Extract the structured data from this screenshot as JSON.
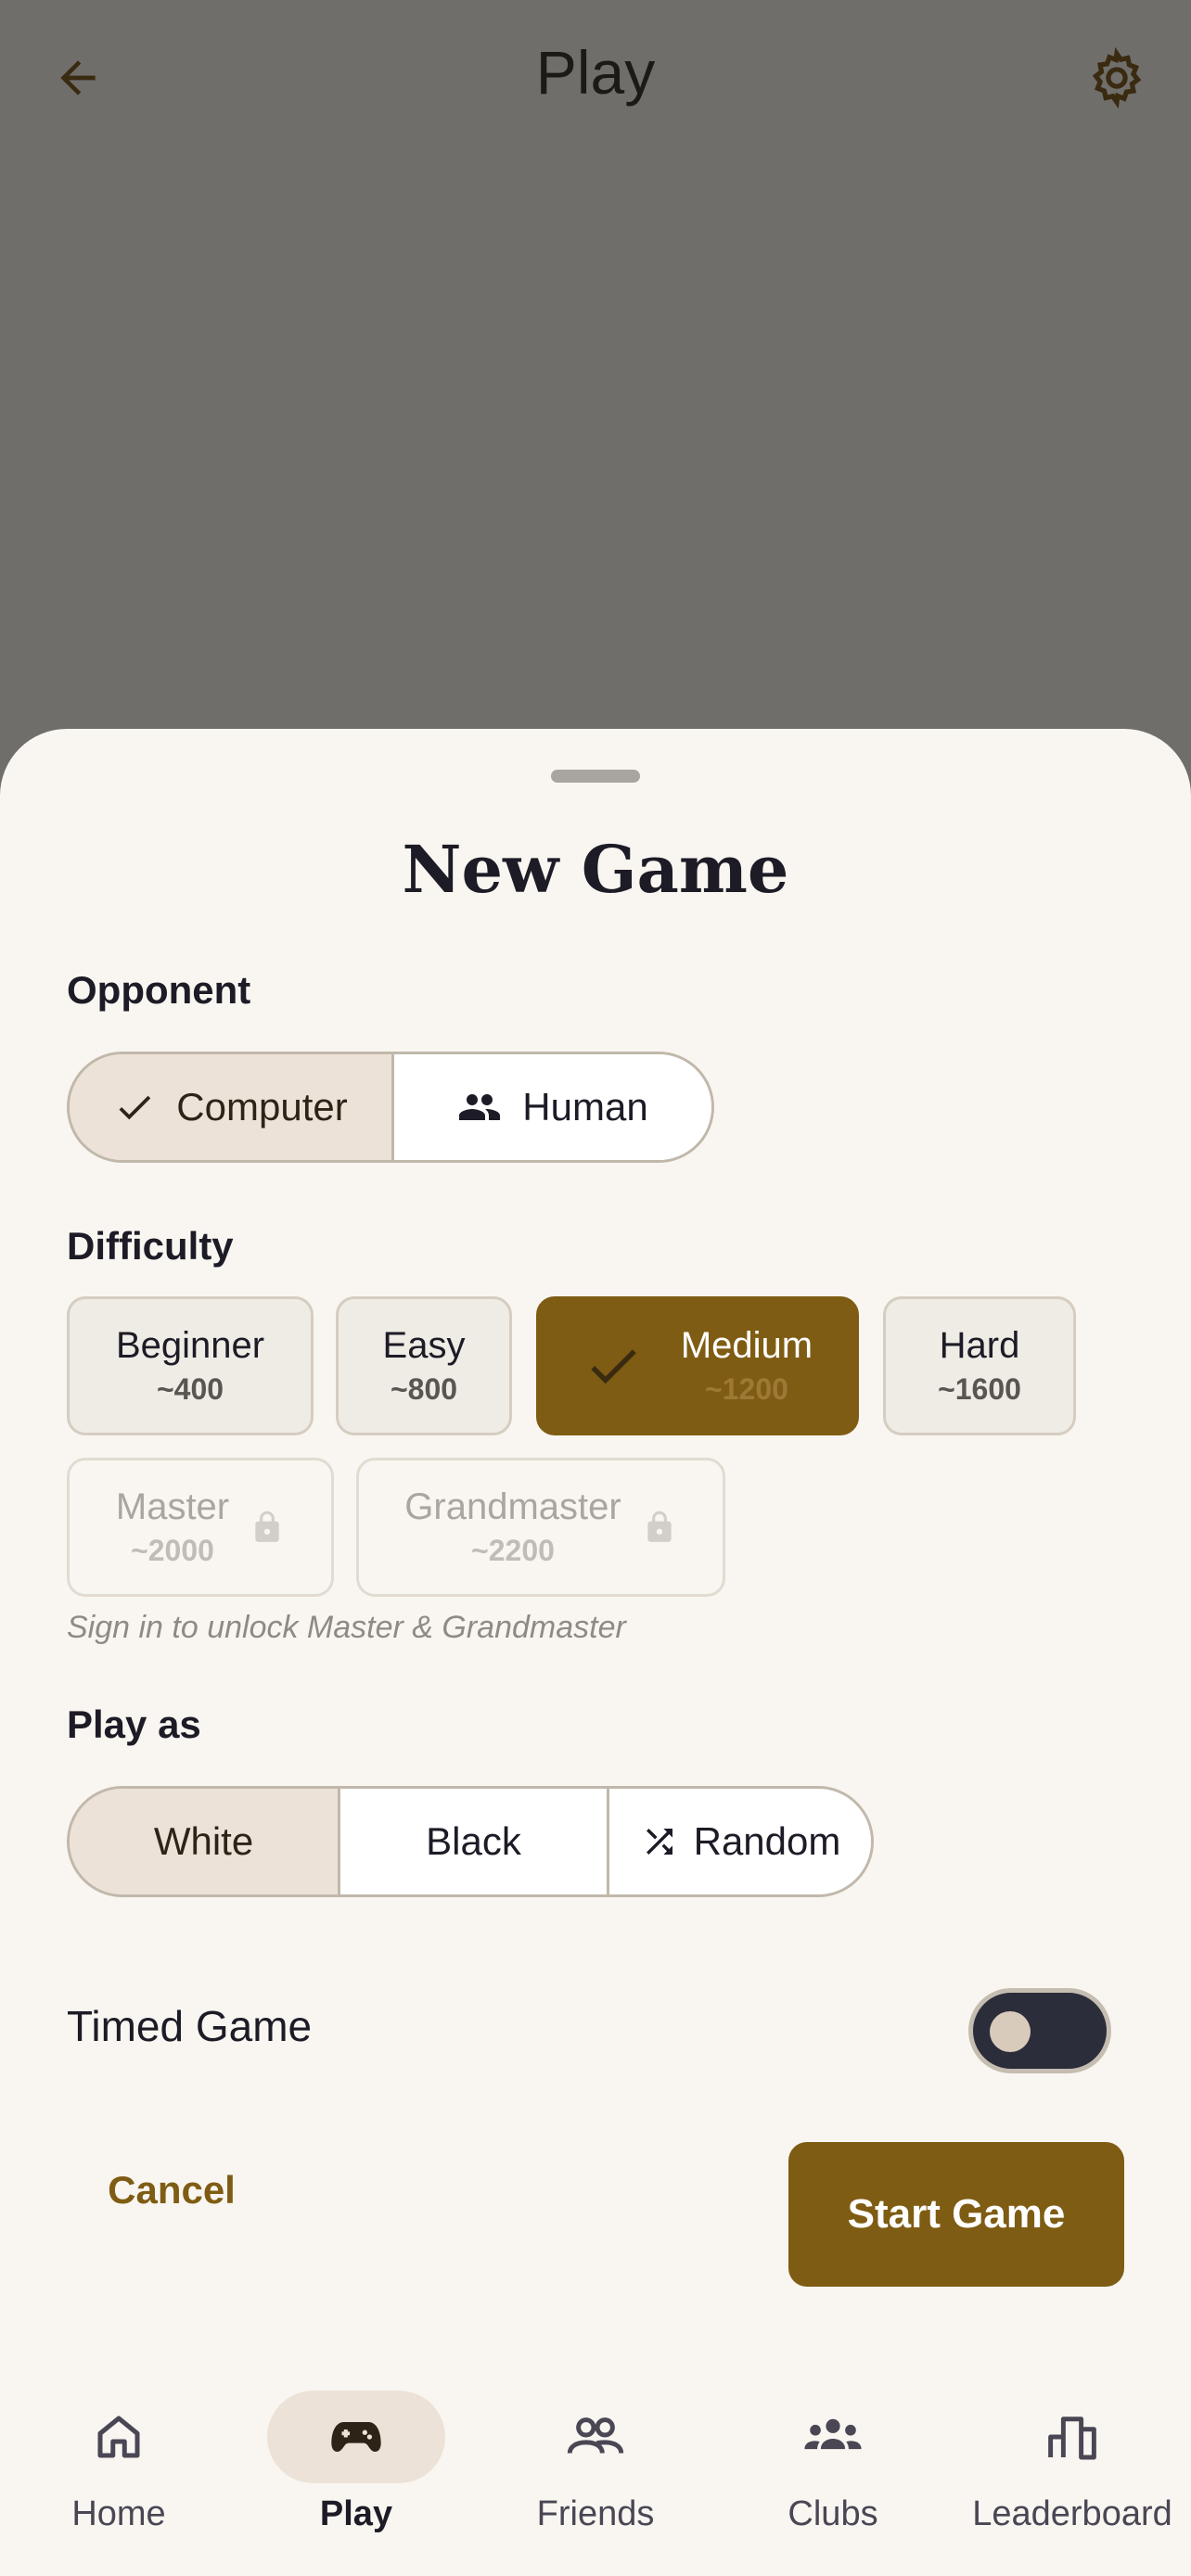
{
  "app_bar": {
    "title": "Play"
  },
  "sheet": {
    "title": "New Game",
    "opponent": {
      "label": "Opponent",
      "options": [
        "Computer",
        "Human"
      ],
      "selected": "Computer"
    },
    "difficulty": {
      "label": "Difficulty",
      "levels": [
        {
          "name": "Beginner",
          "elo": "~400"
        },
        {
          "name": "Easy",
          "elo": "~800"
        },
        {
          "name": "Medium",
          "elo": "~1200"
        },
        {
          "name": "Hard",
          "elo": "~1600"
        },
        {
          "name": "Master",
          "elo": "~2000"
        },
        {
          "name": "Grandmaster",
          "elo": "~2200"
        }
      ],
      "selected": "Medium",
      "locked": [
        "Master",
        "Grandmaster"
      ],
      "note": "Sign in to unlock Master & Grandmaster"
    },
    "play_as": {
      "label": "Play as",
      "options": [
        "White",
        "Black",
        "Random"
      ],
      "selected": "White"
    },
    "timed_game": {
      "label": "Timed Game",
      "enabled": false
    },
    "cancel_label": "Cancel",
    "start_label": "Start Game"
  },
  "nav": {
    "items": [
      {
        "label": "Home",
        "icon": "home-icon"
      },
      {
        "label": "Play",
        "icon": "gamepad-icon"
      },
      {
        "label": "Friends",
        "icon": "friends-icon"
      },
      {
        "label": "Clubs",
        "icon": "clubs-icon"
      },
      {
        "label": "Leaderboard",
        "icon": "leaderboard-icon"
      }
    ],
    "active": "Play"
  },
  "colors": {
    "accent": "#7f5c13",
    "scrim": "#6f6e6b",
    "sheet_bg": "#f9f6f1",
    "selected_bg": "#ede2d7",
    "toggle_track": "#2c2d3a"
  }
}
